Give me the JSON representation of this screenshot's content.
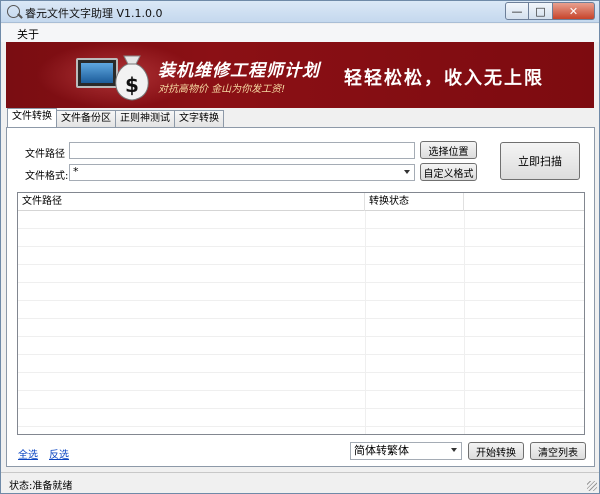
{
  "window": {
    "title": "睿元文件文字助理 V1.1.0.0",
    "min_glyph": "—",
    "max_glyph": "□",
    "close_glyph": "✕"
  },
  "menu": {
    "about": "关于"
  },
  "banner": {
    "title": "装机维修工程师计划",
    "subtitle": "对抗高物价 金山为你发工资!",
    "slogan": "轻轻松松，收入无上限",
    "bag_symbol": "$"
  },
  "tabs": [
    {
      "label": "文件转换",
      "active": true
    },
    {
      "label": "文件备份区",
      "active": false
    },
    {
      "label": "正则神测试",
      "active": false
    },
    {
      "label": "文字转换",
      "active": false
    }
  ],
  "form": {
    "path_label": "文件路径",
    "path_value": "",
    "format_label": "文件格式:",
    "format_value": "*",
    "choose_location_button": "选择位置",
    "custom_format_button": "自定义格式",
    "scan_button": "立即扫描"
  },
  "list": {
    "columns": [
      "文件路径",
      "转换状态",
      ""
    ],
    "rows": []
  },
  "bottom": {
    "select_all": "全选",
    "invert_select": "反选",
    "convert_mode_value": "简体转繁体",
    "start_button": "开始转换",
    "clear_button": "清空列表"
  },
  "status": {
    "text": "状态:准备就绪"
  },
  "colors": {
    "banner_bg": "#7a0d12",
    "banner_accent": "#f6d9a2",
    "link": "#0b45c2",
    "close_button": "#c7442b"
  },
  "icons": {
    "app": "magnifier-icon",
    "banner": "money-bag-icon",
    "combo": "chevron-down-icon"
  }
}
